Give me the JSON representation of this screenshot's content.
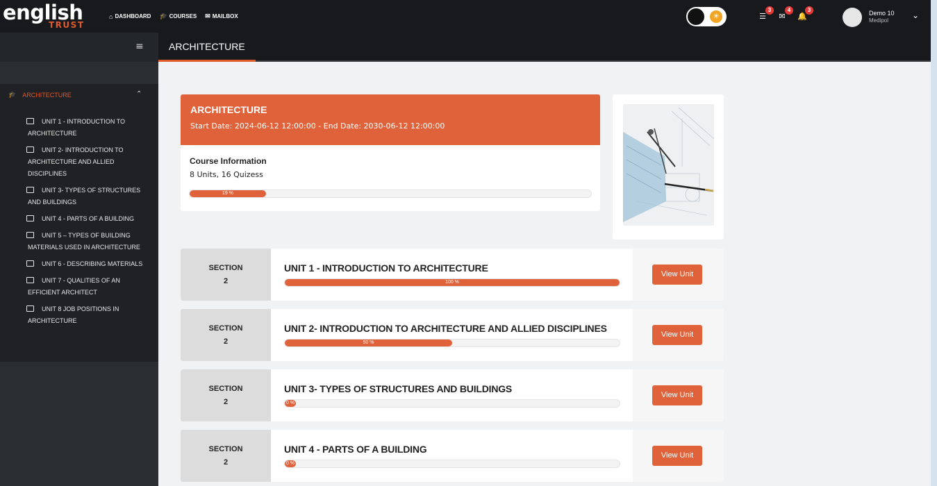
{
  "brand": {
    "logo_main": "english",
    "logo_sub": "TRUST"
  },
  "nav": [
    {
      "icon": "home-icon",
      "label": "DASHBOARD"
    },
    {
      "icon": "graduation-cap-icon",
      "label": "COURSES"
    },
    {
      "icon": "mail-icon",
      "label": "MAILBOX"
    }
  ],
  "notifications": [
    {
      "icon": "list-icon",
      "count": "3"
    },
    {
      "icon": "envelope-icon",
      "count": "4"
    },
    {
      "icon": "bell-icon",
      "count": "3"
    }
  ],
  "user": {
    "name": "Demo 10",
    "org": "Medipol"
  },
  "subbar": {
    "active_tab": "ARCHITECTURE"
  },
  "sidebar": {
    "heading": "ARCHITECTURE",
    "items": [
      "UNIT 1 - INTRODUCTION TO ARCHITECTURE",
      "UNIT 2- INTRODUCTION TO ARCHITECTURE AND ALLIED DISCIPLINES",
      "UNIT 3- TYPES OF STRUCTURES AND BUILDINGS",
      "UNIT 4 - PARTS OF A BUILDING",
      "UNIT 5 – TYPES OF BUILDING MATERIALS USED IN ARCHITECTURE",
      "UNIT 6 - DESCRIBING MATERIALS",
      "UNIT 7 - QUALITIES OF AN EFFICIENT ARCHITECT",
      "UNIT 8 JOB POSITIONS IN ARCHITECTURE"
    ]
  },
  "course": {
    "title": "ARCHITECTURE",
    "dates": "Start Date: 2024-06-12 12:00:00 - End Date: 2030-06-12 12:00:00",
    "info_title": "Course Information",
    "units_summary": "8 Units, 16 Quizess",
    "progress": 19,
    "progress_label": "19 %"
  },
  "units": [
    {
      "section_label": "SECTION",
      "section_num": "2",
      "title": "UNIT 1 - INTRODUCTION TO ARCHITECTURE",
      "progress": 100,
      "progress_label": "100 %",
      "button": "View Unit"
    },
    {
      "section_label": "SECTION",
      "section_num": "2",
      "title": "UNIT 2- INTRODUCTION TO ARCHITECTURE AND ALLIED DISCIPLINES",
      "progress": 50,
      "progress_label": "50 %",
      "button": "View Unit"
    },
    {
      "section_label": "SECTION",
      "section_num": "2",
      "title": "UNIT 3- TYPES OF STRUCTURES AND BUILDINGS",
      "progress": 0,
      "progress_label": "0 %",
      "button": "View Unit"
    },
    {
      "section_label": "SECTION",
      "section_num": "2",
      "title": "UNIT 4 - PARTS OF A BUILDING",
      "progress": 0,
      "progress_label": "0 %",
      "button": "View Unit"
    }
  ],
  "colors": {
    "accent": "#e0623a",
    "topbar": "#17191d",
    "sidebar": "#1f2125"
  }
}
